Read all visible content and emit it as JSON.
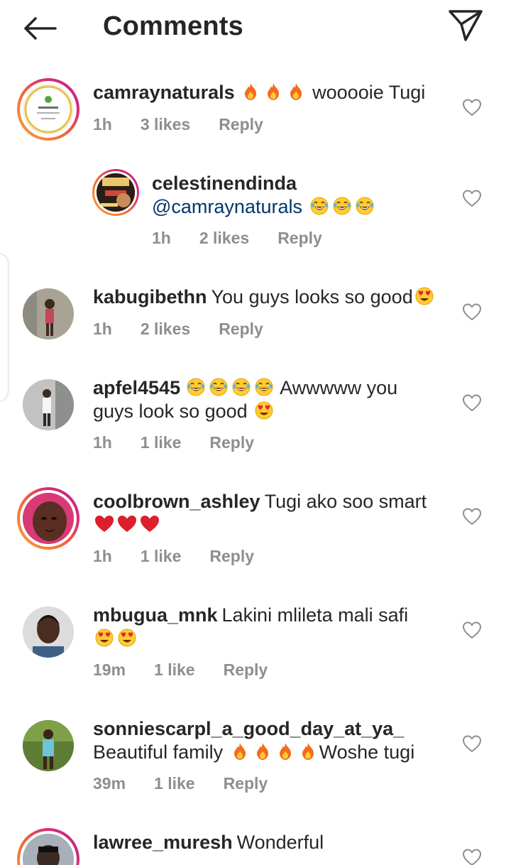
{
  "header": {
    "title": "Comments",
    "back_icon": "back-arrow-icon",
    "share_icon": "paper-plane-icon"
  },
  "comments": [
    {
      "username": "camraynaturals",
      "pre": "",
      "emojis": [
        "fire",
        "fire",
        "fire"
      ],
      "text": "wooooie Tugi",
      "time": "1h",
      "likes": "3 likes",
      "reply": "Reply",
      "story_ring": true
    },
    {
      "username": "celestinendinda",
      "mention": "@camraynaturals",
      "emojis": [
        "laughing",
        "laughing",
        "laughing"
      ],
      "time": "1h",
      "likes": "2 likes",
      "reply": "Reply",
      "story_ring": true,
      "is_reply": true
    },
    {
      "username": "kabugibethn",
      "text": "You guys looks so good",
      "emojis": [
        "heart-eyes"
      ],
      "time": "1h",
      "likes": "2 likes",
      "reply": "Reply"
    },
    {
      "username": "apfel4545",
      "emojis": [
        "laughing",
        "laughing",
        "laughing",
        "laughing"
      ],
      "text": "Awwwww you",
      "text2": "guys look so good",
      "emojis2": [
        "heart-eyes"
      ],
      "time": "1h",
      "likes": "1 like",
      "reply": "Reply"
    },
    {
      "username": "coolbrown_ashley",
      "text": "Tugi ako soo smart",
      "emojis2": [
        "red-heart",
        "red-heart",
        "red-heart"
      ],
      "time": "1h",
      "likes": "1 like",
      "reply": "Reply",
      "story_ring": true
    },
    {
      "username": "mbugua_mnk",
      "text": "Lakini mlileta mali safi",
      "emojis2": [
        "heart-eyes",
        "heart-eyes"
      ],
      "time": "19m",
      "likes": "1 like",
      "reply": "Reply"
    },
    {
      "username": "sonniescarpl_a_good_day_at_ya_",
      "text": "Beautiful family",
      "emojis2": [
        "fire",
        "fire",
        "fire",
        "fire"
      ],
      "text2": "Woshe tugi",
      "time": "39m",
      "likes": "1 like",
      "reply": "Reply"
    },
    {
      "username": "lawree_muresh",
      "text": "Wonderful",
      "story_ring": true
    }
  ],
  "colors": {
    "text": "#262626",
    "meta": "#8e8e8e",
    "mention": "#00376b",
    "ring_start": "#f9a13a",
    "ring_end": "#b42a8c"
  }
}
